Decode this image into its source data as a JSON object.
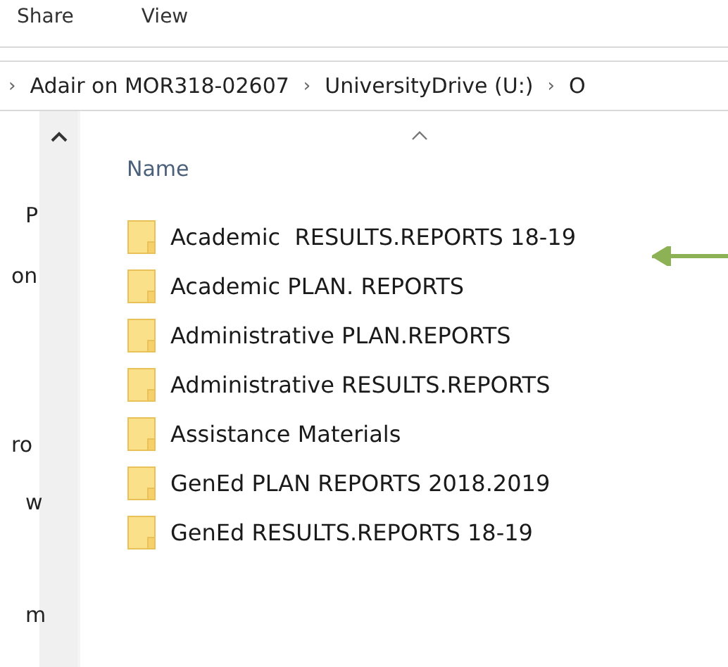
{
  "ribbon_tabs": [
    {
      "label": "Share"
    },
    {
      "label": "View"
    }
  ],
  "breadcrumb": [
    {
      "label": "Adair on MOR318-02607"
    },
    {
      "label": "UniversityDrive (U:)"
    },
    {
      "label": "O"
    }
  ],
  "breadcrumb_separator": "›",
  "navigation_pane": {
    "items": [
      {
        "label": "P"
      },
      {
        "label": "on"
      },
      {
        "label": "ro"
      },
      {
        "label": "w"
      },
      {
        "label": "m"
      }
    ]
  },
  "file_list": {
    "columns": [
      {
        "label": "Name",
        "sorted": true
      }
    ],
    "rows": [
      {
        "name": "Academic  RESULTS.REPORTS 18-19",
        "annotated": true
      },
      {
        "name": "Academic PLAN. REPORTS",
        "annotated": false
      },
      {
        "name": "Administrative PLAN.REPORTS",
        "annotated": false
      },
      {
        "name": "Administrative RESULTS.REPORTS",
        "annotated": false
      },
      {
        "name": "Assistance Materials",
        "annotated": false
      },
      {
        "name": "GenEd PLAN REPORTS 2018.2019",
        "annotated": false
      },
      {
        "name": "GenEd RESULTS.REPORTS 18-19",
        "annotated": false
      }
    ]
  }
}
